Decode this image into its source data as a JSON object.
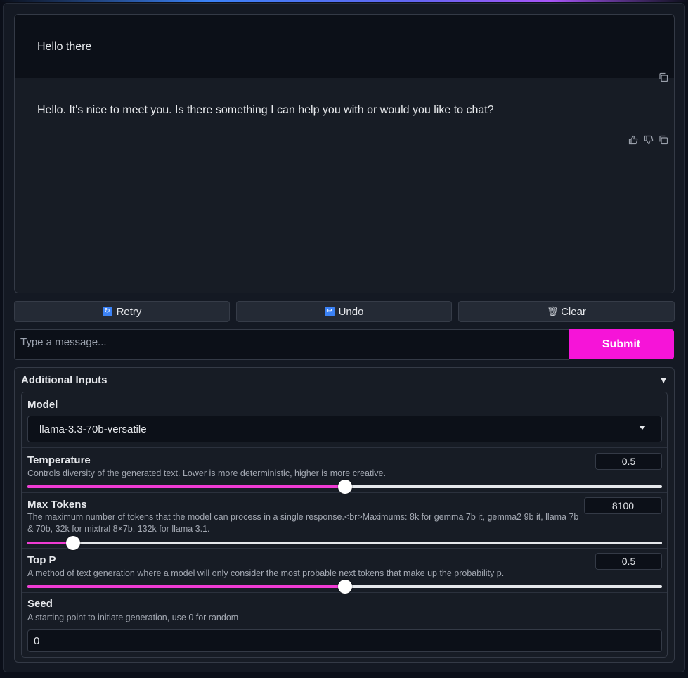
{
  "chat": {
    "user_message": "Hello there",
    "bot_message": "Hello. It's nice to meet you. Is there something I can help you with or would you like to chat?"
  },
  "icons": {
    "copy": "copy-icon",
    "like": "thumbs-up-icon",
    "dislike": "thumbs-down-icon",
    "retry": "retry-icon",
    "undo": "undo-icon",
    "clear": "trash-icon"
  },
  "actions": {
    "retry_label": "Retry",
    "undo_label": "Undo",
    "clear_label": "Clear"
  },
  "input": {
    "placeholder": "Type a message...",
    "value": "",
    "submit_label": "Submit"
  },
  "accordion": {
    "title": "Additional Inputs",
    "model": {
      "label": "Model",
      "selected": "llama-3.3-70b-versatile"
    },
    "temperature": {
      "label": "Temperature",
      "description": "Controls diversity of the generated text. Lower is more deterministic, higher is more creative.",
      "value": "0.5",
      "fraction": 0.5
    },
    "max_tokens": {
      "label": "Max Tokens",
      "description": "The maximum number of tokens that the model can process in a single response.<br>Maximums: 8k for gemma 7b it, gemma2 9b it, llama 7b & 70b, 32k for mixtral 8×7b, 132k for llama 3.1.",
      "value": "8100",
      "fraction": 0.072
    },
    "top_p": {
      "label": "Top P",
      "description": "A method of text generation where a model will only consider the most probable next tokens that make up the probability p.",
      "value": "0.5",
      "fraction": 0.5
    },
    "seed": {
      "label": "Seed",
      "description": "A starting point to initiate generation, use 0 for random",
      "value": "0"
    }
  },
  "colors": {
    "accent": "#f614d8",
    "slider_fill": "#f03bd4",
    "background": "#0b0f19"
  }
}
